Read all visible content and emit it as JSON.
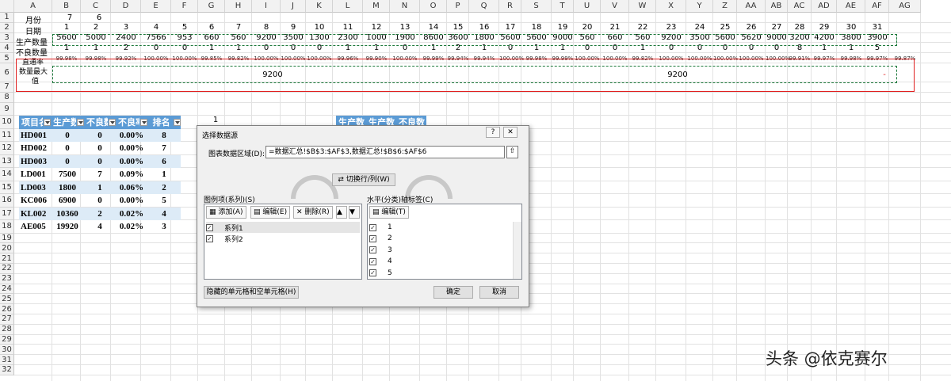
{
  "columns": [
    "A",
    "B",
    "C",
    "D",
    "E",
    "F",
    "G",
    "H",
    "I",
    "J",
    "K",
    "L",
    "M",
    "N",
    "O",
    "P",
    "Q",
    "R",
    "S",
    "T",
    "U",
    "V",
    "W",
    "X",
    "Y",
    "Z",
    "AA",
    "AB",
    "AC",
    "AD",
    "AE",
    "AF",
    "AG"
  ],
  "rows": [
    "1",
    "2",
    "3",
    "4",
    "5",
    "6",
    "7",
    "8",
    "9",
    "10",
    "11",
    "12",
    "13",
    "14",
    "15",
    "16",
    "17",
    "18",
    "19",
    "20",
    "21",
    "22",
    "23",
    "24",
    "25",
    "26",
    "27",
    "28",
    "29",
    "30",
    "31",
    "32"
  ],
  "labels": {
    "month": "月份",
    "date": "日期",
    "production": "生产数量",
    "defect": "不良数量",
    "passrate": "直通率",
    "max_line1": "数量最大",
    "max_line2": "值"
  },
  "month_values": [
    "7",
    "6"
  ],
  "dates": [
    "1",
    "2",
    "3",
    "4",
    "5",
    "6",
    "7",
    "8",
    "9",
    "10",
    "11",
    "12",
    "13",
    "14",
    "15",
    "16",
    "17",
    "18",
    "19",
    "20",
    "21",
    "22",
    "23",
    "24",
    "25",
    "26",
    "27",
    "28",
    "29",
    "30",
    "31"
  ],
  "production": [
    "5600",
    "5000",
    "2400",
    "7566",
    "953",
    "660",
    "560",
    "9200",
    "3500",
    "1300",
    "2300",
    "1000",
    "1900",
    "8600",
    "3600",
    "1800",
    "5600",
    "5600",
    "9000",
    "560",
    "660",
    "560",
    "9200",
    "3500",
    "5600",
    "5620",
    "9000",
    "3200",
    "4200",
    "3800",
    "3900"
  ],
  "defects": [
    "1",
    "1",
    "2",
    "0",
    "0",
    "1",
    "1",
    "0",
    "0",
    "0",
    "1",
    "1",
    "0",
    "1",
    "2",
    "1",
    "0",
    "1",
    "1",
    "0",
    "0",
    "1",
    "0",
    "0",
    "0",
    "0",
    "0",
    "8",
    "1",
    "1",
    "5"
  ],
  "passrates": [
    "99.98%",
    "99.98%",
    "99.92%",
    "100.00%",
    "100.00%",
    "99.85%",
    "99.82%",
    "100.00%",
    "100.00%",
    "100.00%",
    "99.96%",
    "99.90%",
    "100.00%",
    "99.99%",
    "99.94%",
    "99.94%",
    "100.00%",
    "99.98%",
    "99.99%",
    "100.00%",
    "100.00%",
    "99.82%",
    "100.00%",
    "100.00%",
    "100.00%",
    "100.00%",
    "100.00%",
    "99.91%",
    "99.97%",
    "99.98%",
    "99.97%",
    "99.87%"
  ],
  "max_values": {
    "col_i": "9200",
    "col_x": "9200",
    "col_af": "-"
  },
  "row9_value": "1",
  "table": {
    "headers": [
      "项目名",
      "生产数",
      "不良数",
      "不良率",
      "排名"
    ],
    "rows": [
      [
        "HD001",
        "0",
        "0",
        "0.00%",
        "8"
      ],
      [
        "HD002",
        "0",
        "0",
        "0.00%",
        "7"
      ],
      [
        "HD003",
        "0",
        "0",
        "0.00%",
        "6"
      ],
      [
        "LD001",
        "7500",
        "7",
        "0.09%",
        "1"
      ],
      [
        "LD003",
        "1800",
        "1",
        "0.06%",
        "2"
      ],
      [
        "KC006",
        "6900",
        "0",
        "0.00%",
        "5"
      ],
      [
        "KL002",
        "10360",
        "2",
        "0.02%",
        "4"
      ],
      [
        "AE005",
        "19920",
        "4",
        "0.02%",
        "3"
      ]
    ]
  },
  "table2_headers": [
    "生产数",
    "生产数",
    "不良数"
  ],
  "dialog": {
    "title": "选择数据源",
    "help": "?",
    "close": "✕",
    "range_label": "图表数据区域(D):",
    "range_value": "=数据汇总!$B$3:$AF$3,数据汇总!$B$6:$AF$6",
    "switch_label": "切换行/列(W)",
    "series_label": "图例项(系列)(S)",
    "add_label": "添加(A)",
    "edit_label": "编辑(E)",
    "delete_label": "删除(R)",
    "series": [
      "系列1",
      "系列2"
    ],
    "axis_label": "水平(分类)轴标签(C)",
    "axis_edit_label": "编辑(T)",
    "axis_items": [
      "1",
      "2",
      "3",
      "4",
      "5"
    ],
    "hidden_cells_label": "隐藏的单元格和空单元格(H)",
    "ok_label": "确定",
    "cancel_label": "取消"
  },
  "watermark": "头条 @依克赛尔",
  "colors": {
    "header_blue": "#5b9bd5",
    "band_blue": "#ddebf7",
    "dash_green": "#1e7a3c",
    "red_box": "#e02020"
  }
}
